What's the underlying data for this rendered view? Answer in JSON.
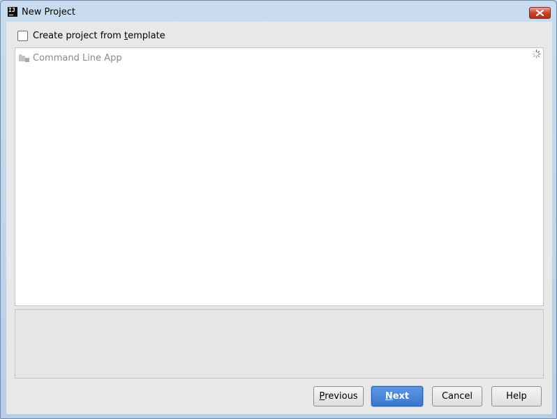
{
  "window": {
    "title": "New Project",
    "app_icon_text": "IJ"
  },
  "template": {
    "label_pre": "Create project from ",
    "label_mnemonic": "t",
    "label_post": "emplate",
    "checked": false
  },
  "project_types": [
    {
      "label": "Command Line App",
      "icon": "folder-icon"
    }
  ],
  "buttons": {
    "previous": {
      "mnemonic": "P",
      "rest": "revious"
    },
    "next": {
      "mnemonic": "N",
      "rest": "ext"
    },
    "cancel": {
      "label": "Cancel"
    },
    "help": {
      "label": "Help"
    }
  },
  "colors": {
    "accent": "#3a76cf",
    "close": "#c9452f"
  }
}
